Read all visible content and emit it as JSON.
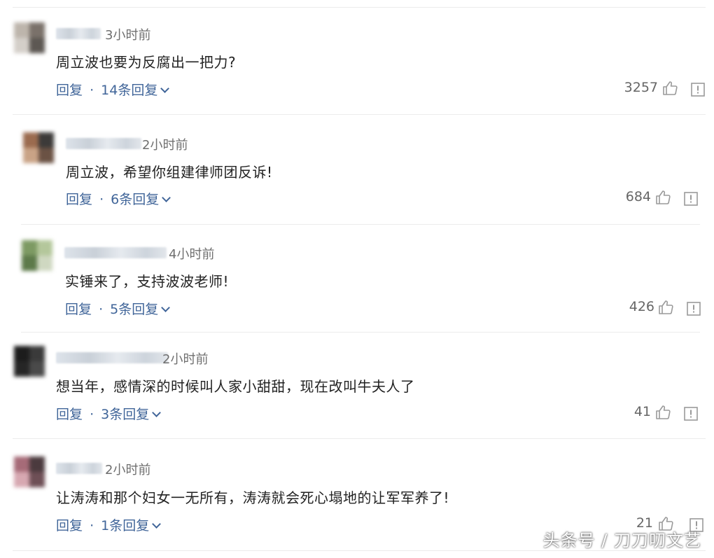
{
  "comments": [
    {
      "time": "3小时前",
      "text": "周立波也要为反腐出一把力?",
      "reply_label": "回复",
      "reply_count": "14条回复",
      "likes": "3257",
      "avatar_colors": [
        "#bdb5ac",
        "#7a716a",
        "#d4cfc9",
        "#5d5853"
      ]
    },
    {
      "time": "2小时前",
      "text": "周立波，希望你组建律师团反诉!",
      "reply_label": "回复",
      "reply_count": "6条回复",
      "likes": "684",
      "avatar_colors": [
        "#9b6b4f",
        "#3c3a39",
        "#c9a386",
        "#6b5244"
      ]
    },
    {
      "time": "4小时前",
      "text": "实锤来了，支持波波老师!",
      "reply_label": "回复",
      "reply_count": "5条回复",
      "likes": "426",
      "avatar_colors": [
        "#7d9a63",
        "#b4c79b",
        "#5d7a4a",
        "#cfd8c1"
      ]
    },
    {
      "time": "2小时前",
      "text": "想当年，感情深的时候叫人家小甜甜，现在改叫牛夫人了",
      "reply_label": "回复",
      "reply_count": "3条回复",
      "likes": "41",
      "avatar_colors": [
        "#1c1c1c",
        "#3a3a3a",
        "#262626",
        "#4a4a4a"
      ]
    },
    {
      "time": "2小时前",
      "text": "让涛涛和那个妇女一无所有，涛涛就会死心塌地的让军军养了!",
      "reply_label": "回复",
      "reply_count": "1条回复",
      "likes": "21",
      "avatar_colors": [
        "#a66b78",
        "#4b3a3e",
        "#d7a8b1",
        "#6e4f56"
      ]
    }
  ],
  "reply_separator": "·",
  "watermark": "头条号 / 刀刀叨文艺",
  "colors": {
    "link": "#406599",
    "text": "#222222",
    "muted": "#6f6f6f"
  }
}
